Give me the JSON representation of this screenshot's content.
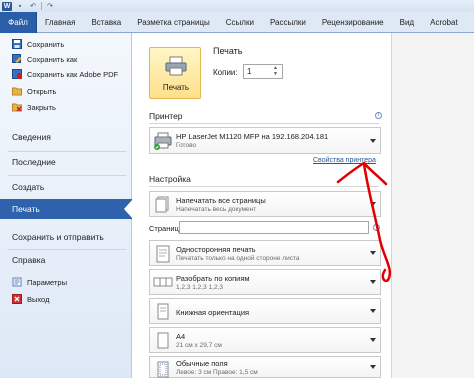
{
  "window": {
    "file_tab": "Файл",
    "tabs": [
      "Главная",
      "Вставка",
      "Разметка страницы",
      "Ссылки",
      "Рассылки",
      "Рецензирование",
      "Вид",
      "Acrobat"
    ]
  },
  "backstage": {
    "commands": [
      {
        "label": "Сохранить",
        "icon": "save-icon"
      },
      {
        "label": "Сохранить как",
        "icon": "save-as-icon"
      },
      {
        "label": "Сохранить как Adobe PDF",
        "icon": "pdf-icon"
      },
      {
        "label": "Открыть",
        "icon": "open-folder-icon"
      },
      {
        "label": "Закрыть",
        "icon": "close-document-icon"
      }
    ],
    "sections": [
      "Сведения",
      "Последние",
      "Создать",
      "Печать",
      "Сохранить и отправить",
      "Справка"
    ],
    "active_section": "Печать",
    "footer_commands": [
      {
        "label": "Параметры",
        "icon": "options-icon"
      },
      {
        "label": "Выход",
        "icon": "exit-icon"
      }
    ]
  },
  "print": {
    "heading": "Печать",
    "button_label": "Печать",
    "copies_label": "Копии:",
    "copies_value": "1",
    "printer_heading": "Принтер",
    "printer_name": "HP LaserJet M1120 MFP на 192.168.204.181",
    "printer_status": "Готово",
    "printer_properties_link": "Свойства принтера",
    "settings_heading": "Настройка",
    "pages_label": "Страницы:",
    "pages_value": "",
    "settings": [
      {
        "title": "Напечатать все страницы",
        "subtitle": "Напечатать весь документ",
        "icon": "pages-icon"
      },
      {
        "title": "Односторонняя печать",
        "subtitle": "Печатать только на одной стороне листа",
        "icon": "one-sided-icon"
      },
      {
        "title": "Разобрать по копиям",
        "subtitle": "1,2,3    1,2,3    1,2,3",
        "icon": "collate-icon"
      },
      {
        "title": "Книжная ориентация",
        "subtitle": "",
        "icon": "portrait-icon"
      },
      {
        "title": "A4",
        "subtitle": "21 см x 29,7 см",
        "icon": "paper-size-icon"
      },
      {
        "title": "Обычные поля",
        "subtitle": "Левое: 3 см    Правое: 1,5 см",
        "icon": "margins-icon"
      }
    ]
  },
  "colors": {
    "file_tab": "#2a5ea8",
    "active_section": "#2e62ad",
    "annotation": "#e00000",
    "print_button": "#fde08a"
  }
}
